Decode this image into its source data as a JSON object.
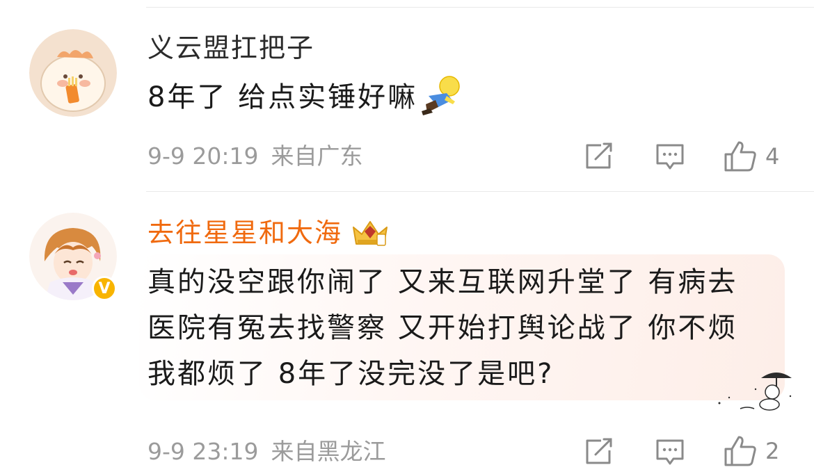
{
  "comments": [
    {
      "username": "义云盟扛把子",
      "content": "8年了  给点实锤好嘛",
      "emoji_icon": "flying-figure-emoji",
      "date": "9-9 20:19",
      "location": "来自广东",
      "like_count": "4"
    },
    {
      "username": "去往星星和大海",
      "username_color": "#f06a0f",
      "member_badge_icon": "crown-badge-icon",
      "verified_badge": "V",
      "content_lines": [
        "真的没空跟你闹了 又来互联网升堂了 有病去",
        "医院有冤去找警察 又开始打舆论战了 你不烦",
        "我都烦了 8年了没完没了是吧?"
      ],
      "date": "9-9 23:19",
      "location": "来自黑龙江",
      "like_count": "2"
    }
  ],
  "colors": {
    "meta_gray": "#9b9b9b",
    "icon_gray": "#8a8a8a",
    "divider": "#e9e9e9"
  }
}
